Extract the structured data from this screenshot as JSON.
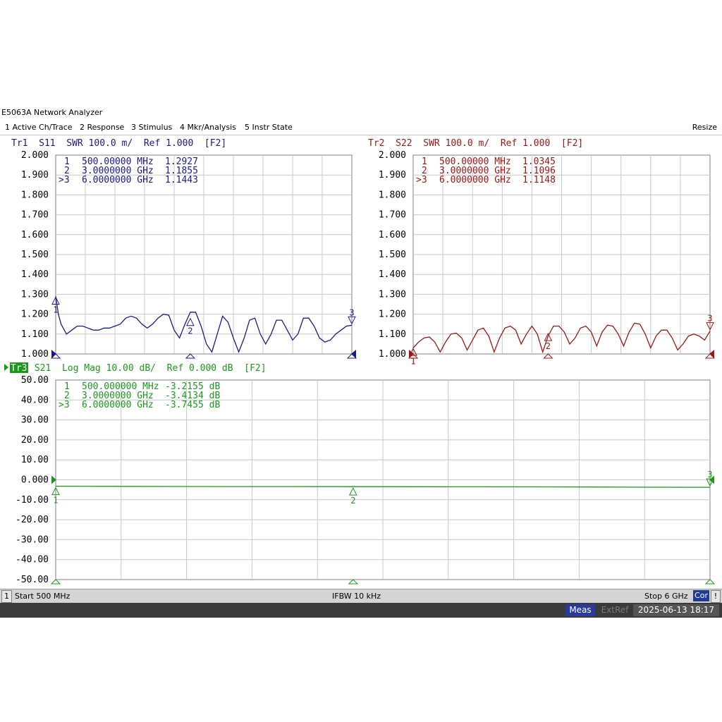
{
  "window": {
    "title": "E5063A Network Analyzer"
  },
  "menu": {
    "items": [
      {
        "label": "1 Active Ch/Trace"
      },
      {
        "label": "2 Response"
      },
      {
        "label": "3 Stimulus"
      },
      {
        "label": "4 Mkr/Analysis"
      },
      {
        "label": "5 Instr State"
      }
    ],
    "resize_label": "Resize"
  },
  "colors": {
    "tr1": "#1a1a8c",
    "tr2": "#a01616",
    "tr3": "#1a9a1a",
    "grid": "#c8c8c8"
  },
  "traces": [
    {
      "id": "tr1",
      "header": "Tr1  S11  SWR 100.0 m/  Ref 1.000  [F2]",
      "yticks": [
        "2.000",
        "1.900",
        "1.800",
        "1.700",
        "1.600",
        "1.500",
        "1.400",
        "1.300",
        "1.200",
        "1.100",
        "1.000"
      ],
      "markers": [
        {
          "label": "1",
          "freq": "500.00000 MHz",
          "value": "1.2927"
        },
        {
          "label": "2",
          "freq": "3.0000000 GHz",
          "value": "1.1855"
        },
        {
          "label": ">3",
          "freq": "6.0000000 GHz",
          "value": "1.1443"
        }
      ]
    },
    {
      "id": "tr2",
      "header": "Tr2  S22  SWR 100.0 m/  Ref 1.000  [F2]",
      "yticks": [
        "2.000",
        "1.900",
        "1.800",
        "1.700",
        "1.600",
        "1.500",
        "1.400",
        "1.300",
        "1.200",
        "1.100",
        "1.000"
      ],
      "markers": [
        {
          "label": "1",
          "freq": "500.00000 MHz",
          "value": "1.0345"
        },
        {
          "label": "2",
          "freq": "3.0000000 GHz",
          "value": "1.1096"
        },
        {
          "label": ">3",
          "freq": "6.0000000 GHz",
          "value": "1.1148"
        }
      ]
    },
    {
      "id": "tr3",
      "tag": "Tr3",
      "header": " S21  Log Mag 10.00 dB/  Ref 0.000 dB  [F2]",
      "yticks": [
        "50.00",
        "40.00",
        "30.00",
        "20.00",
        "10.00",
        "0.000",
        "-10.00",
        "-20.00",
        "-30.00",
        "-40.00",
        "-50.00"
      ],
      "markers": [
        {
          "label": "1",
          "freq": "500.000000 MHz",
          "value": "-3.2155 dB"
        },
        {
          "label": "2",
          "freq": "3.0000000 GHz",
          "value": "-3.4134 dB"
        },
        {
          "label": ">3",
          "freq": "6.0000000 GHz",
          "value": "-3.7455 dB"
        }
      ]
    }
  ],
  "chart_data": [
    {
      "type": "line",
      "xlabel": "",
      "ylabel": "",
      "xlim_ghz": [
        0.5,
        6.0
      ],
      "ylim": [
        1.0,
        2.0
      ],
      "series": [
        {
          "name": "S11",
          "x_ghz": [
            0.5,
            0.55,
            0.6,
            0.7,
            0.8,
            0.9,
            1.0,
            1.1,
            1.2,
            1.3,
            1.4,
            1.5,
            1.6,
            1.7,
            1.8,
            1.9,
            2.0,
            2.1,
            2.2,
            2.3,
            2.4,
            2.5,
            2.6,
            2.7,
            2.8,
            2.9,
            3.0,
            3.1,
            3.2,
            3.3,
            3.4,
            3.5,
            3.6,
            3.7,
            3.8,
            3.9,
            4.0,
            4.1,
            4.2,
            4.3,
            4.4,
            4.5,
            4.6,
            4.7,
            4.8,
            4.9,
            5.0,
            5.1,
            5.2,
            5.3,
            5.4,
            5.5,
            5.6,
            5.7,
            5.8,
            5.9,
            6.0
          ],
          "values": [
            1.29,
            1.2,
            1.15,
            1.1,
            1.12,
            1.14,
            1.14,
            1.13,
            1.12,
            1.12,
            1.13,
            1.13,
            1.14,
            1.15,
            1.18,
            1.19,
            1.18,
            1.15,
            1.13,
            1.15,
            1.18,
            1.2,
            1.195,
            1.12,
            1.08,
            1.15,
            1.21,
            1.21,
            1.14,
            1.05,
            1.01,
            1.1,
            1.19,
            1.16,
            1.08,
            1.01,
            1.08,
            1.17,
            1.18,
            1.1,
            1.05,
            1.1,
            1.17,
            1.17,
            1.12,
            1.07,
            1.1,
            1.18,
            1.18,
            1.14,
            1.08,
            1.06,
            1.07,
            1.1,
            1.12,
            1.14,
            1.1443
          ]
        }
      ],
      "markers": [
        {
          "x_ghz": 0.5,
          "y": 1.2927
        },
        {
          "x_ghz": 3.0,
          "y": 1.1855
        },
        {
          "x_ghz": 6.0,
          "y": 1.1443
        }
      ]
    },
    {
      "type": "line",
      "xlabel": "",
      "ylabel": "",
      "xlim_ghz": [
        0.5,
        6.0
      ],
      "ylim": [
        1.0,
        2.0
      ],
      "series": [
        {
          "name": "S22",
          "x_ghz": [
            0.5,
            0.6,
            0.7,
            0.8,
            0.9,
            1.0,
            1.1,
            1.2,
            1.3,
            1.4,
            1.5,
            1.6,
            1.7,
            1.8,
            1.9,
            2.0,
            2.1,
            2.2,
            2.3,
            2.4,
            2.5,
            2.6,
            2.7,
            2.8,
            2.9,
            3.0,
            3.1,
            3.2,
            3.3,
            3.4,
            3.5,
            3.6,
            3.7,
            3.8,
            3.9,
            4.0,
            4.1,
            4.2,
            4.3,
            4.4,
            4.5,
            4.6,
            4.7,
            4.8,
            4.9,
            5.0,
            5.1,
            5.2,
            5.3,
            5.4,
            5.5,
            5.6,
            5.7,
            5.8,
            5.9,
            6.0
          ],
          "values": [
            1.03,
            1.06,
            1.08,
            1.085,
            1.06,
            1.01,
            1.06,
            1.1,
            1.105,
            1.08,
            1.02,
            1.07,
            1.12,
            1.13,
            1.09,
            1.01,
            1.08,
            1.13,
            1.14,
            1.12,
            1.05,
            1.1,
            1.14,
            1.1,
            1.01,
            1.09,
            1.14,
            1.14,
            1.11,
            1.05,
            1.08,
            1.13,
            1.14,
            1.11,
            1.04,
            1.11,
            1.145,
            1.14,
            1.1,
            1.04,
            1.11,
            1.155,
            1.15,
            1.1,
            1.03,
            1.09,
            1.12,
            1.12,
            1.08,
            1.02,
            1.05,
            1.09,
            1.1,
            1.09,
            1.07,
            1.1148
          ]
        }
      ],
      "markers": [
        {
          "x_ghz": 0.5,
          "y": 1.0345
        },
        {
          "x_ghz": 3.0,
          "y": 1.1096
        },
        {
          "x_ghz": 6.0,
          "y": 1.1148
        }
      ]
    },
    {
      "type": "line",
      "xlabel": "",
      "ylabel": "",
      "xlim_ghz": [
        0.5,
        6.0
      ],
      "ylim": [
        -50,
        50
      ],
      "series": [
        {
          "name": "S21",
          "x_ghz": [
            0.5,
            1.0,
            1.5,
            2.0,
            2.5,
            3.0,
            3.5,
            4.0,
            4.5,
            5.0,
            5.5,
            6.0
          ],
          "values": [
            -3.2155,
            -3.3,
            -3.35,
            -3.38,
            -3.4,
            -3.4134,
            -3.45,
            -3.5,
            -3.55,
            -3.62,
            -3.7,
            -3.7455
          ]
        }
      ],
      "markers": [
        {
          "x_ghz": 0.5,
          "y": -3.2155
        },
        {
          "x_ghz": 3.0,
          "y": -3.4134
        },
        {
          "x_ghz": 6.0,
          "y": -3.7455
        }
      ]
    }
  ],
  "status": {
    "channel": "1",
    "start": "Start 500 MHz",
    "ifbw": "IFBW 10 kHz",
    "stop": "Stop 6 GHz",
    "cor": "Cor",
    "bang": "!"
  },
  "bottom": {
    "meas": "Meas",
    "extref": "ExtRef",
    "datetime": "2025-06-13 18:17"
  }
}
